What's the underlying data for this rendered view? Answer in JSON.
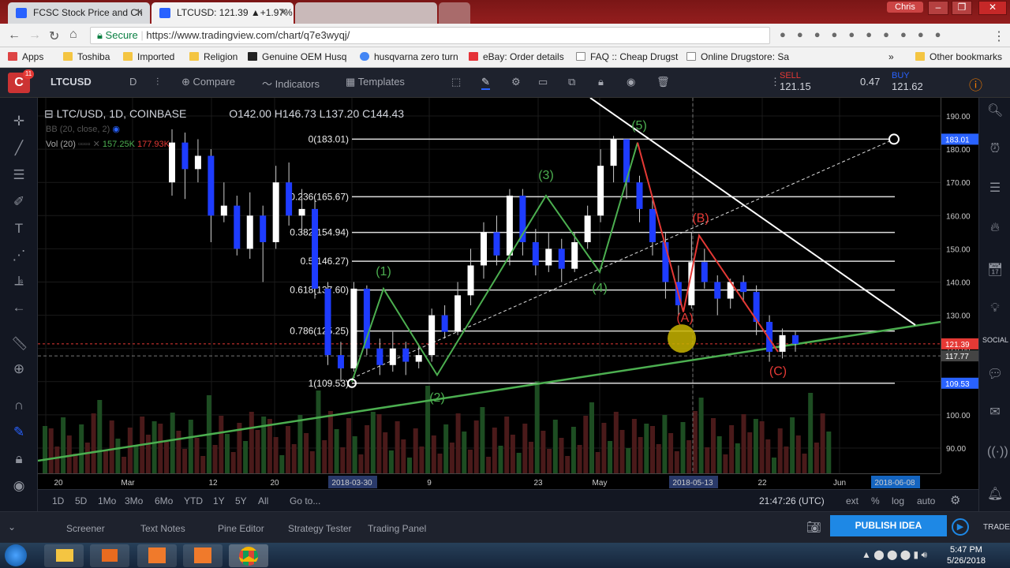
{
  "browser": {
    "tabs": [
      {
        "title": "FCSC Stock Price and Ch",
        "active": false
      },
      {
        "title": "LTCUSD: 121.39 ▲+1.97%",
        "active": true
      },
      {
        "title": "",
        "active": false
      }
    ],
    "profile": "Chris",
    "secure_label": "Secure",
    "url": "https://www.tradingview.com/chart/q7e3wyqj/",
    "bookmarks": [
      "Apps",
      "Toshiba",
      "Imported",
      "Religion",
      "Genuine OEM Husq",
      "husqvarna zero turn",
      "eBay: Order details",
      "FAQ :: Cheap Drugst",
      "Online Drugstore: Sa"
    ],
    "other_bookmarks": "Other bookmarks"
  },
  "tv": {
    "symbol": "LTCUSD",
    "interval": "D",
    "compare": "Compare",
    "indicators": "Indicators",
    "templates": "Templates",
    "sell_label": "SELL",
    "sell_price": "121.15",
    "spread": "0.47",
    "buy_label": "BUY",
    "buy_price": "121.62",
    "legend": {
      "title": "LTC/USD, 1D, COINBASE",
      "o": "O142.00",
      "h": "H146.73",
      "l": "L137.20",
      "c": "C144.43",
      "bb": "BB (20, close, 2)",
      "vol": "Vol (20)",
      "vol_v1": "157.25K",
      "vol_v2": "177.93K"
    },
    "ranges": [
      "1D",
      "5D",
      "1Mo",
      "3Mo",
      "6Mo",
      "YTD",
      "1Y",
      "5Y",
      "All"
    ],
    "goto": "Go to...",
    "clock": "21:47:26 (UTC)",
    "scale_opts": [
      "ext",
      "%",
      "log",
      "auto"
    ],
    "bottom_tabs": [
      "Screener",
      "Text Notes",
      "Pine Editor",
      "Strategy Tester",
      "Trading Panel"
    ],
    "publish": "PUBLISH IDEA",
    "social": "SOCIAL",
    "trade": "TRADE"
  },
  "chart_data": {
    "type": "candlestick",
    "x_ticks": [
      "20",
      "Mar",
      "12",
      "20",
      "2018-03-30",
      "9",
      "23",
      "May",
      "2018-05-13",
      "22",
      "Jun",
      "2018-06-08"
    ],
    "y_ticks": [
      "190.00",
      "180.00",
      "170.00",
      "160.00",
      "150.00",
      "140.00",
      "130.00",
      "120.00",
      "110.00",
      "100.00",
      "90.00"
    ],
    "price_labels": [
      {
        "text": "183.01",
        "color": "#2962ff"
      },
      {
        "text": "121.39",
        "color": "#e53935"
      },
      {
        "text": "117.77",
        "color": "#444444"
      },
      {
        "text": "109.53",
        "color": "#2962ff"
      }
    ],
    "fib_levels": [
      {
        "label": "0(183.01)",
        "price": 183.01
      },
      {
        "label": "0.236(165.67)",
        "price": 165.67
      },
      {
        "label": "0.382(154.94)",
        "price": 154.94
      },
      {
        "label": "0.5(146.27)",
        "price": 146.27
      },
      {
        "label": "0.618(137.60)",
        "price": 137.6
      },
      {
        "label": "0.786(125.25)",
        "price": 125.25
      },
      {
        "label": "1(109.53)",
        "price": 109.53
      }
    ],
    "elliott_labels": [
      {
        "text": "(1)",
        "color": "#4caf50"
      },
      {
        "text": "(2)",
        "color": "#4caf50"
      },
      {
        "text": "(3)",
        "color": "#4caf50"
      },
      {
        "text": "(4)",
        "color": "#4caf50"
      },
      {
        "text": "(5)",
        "color": "#4caf50"
      },
      {
        "text": "(A)",
        "color": "#e53935"
      },
      {
        "text": "(B)",
        "color": "#e53935"
      },
      {
        "text": "(C)",
        "color": "#e53935"
      }
    ],
    "candles": [
      {
        "o": 170,
        "c": 182,
        "h": 186,
        "l": 166
      },
      {
        "o": 182,
        "c": 174,
        "h": 185,
        "l": 165
      },
      {
        "o": 174,
        "c": 178,
        "h": 183,
        "l": 170
      },
      {
        "o": 178,
        "c": 160,
        "h": 180,
        "l": 152
      },
      {
        "o": 160,
        "c": 163,
        "h": 170,
        "l": 158
      },
      {
        "o": 163,
        "c": 150,
        "h": 166,
        "l": 148
      },
      {
        "o": 150,
        "c": 160,
        "h": 167,
        "l": 147
      },
      {
        "o": 160,
        "c": 152,
        "h": 163,
        "l": 140
      },
      {
        "o": 152,
        "c": 170,
        "h": 175,
        "l": 150
      },
      {
        "o": 170,
        "c": 160,
        "h": 176,
        "l": 157
      },
      {
        "o": 160,
        "c": 162,
        "h": 168,
        "l": 155
      },
      {
        "o": 162,
        "c": 138,
        "h": 165,
        "l": 135
      },
      {
        "o": 138,
        "c": 118,
        "h": 140,
        "l": 115
      },
      {
        "o": 118,
        "c": 114,
        "h": 122,
        "l": 110
      },
      {
        "o": 114,
        "c": 138,
        "h": 140,
        "l": 113
      },
      {
        "o": 138,
        "c": 120,
        "h": 139,
        "l": 118
      },
      {
        "o": 120,
        "c": 115,
        "h": 123,
        "l": 112
      },
      {
        "o": 115,
        "c": 120,
        "h": 125,
        "l": 113
      },
      {
        "o": 120,
        "c": 116,
        "h": 122,
        "l": 112
      },
      {
        "o": 116,
        "c": 118,
        "h": 121,
        "l": 114
      },
      {
        "o": 118,
        "c": 130,
        "h": 132,
        "l": 116
      },
      {
        "o": 130,
        "c": 125,
        "h": 133,
        "l": 123
      },
      {
        "o": 125,
        "c": 136,
        "h": 140,
        "l": 124
      },
      {
        "o": 136,
        "c": 145,
        "h": 150,
        "l": 133
      },
      {
        "o": 145,
        "c": 155,
        "h": 158,
        "l": 141
      },
      {
        "o": 155,
        "c": 148,
        "h": 160,
        "l": 145
      },
      {
        "o": 148,
        "c": 166,
        "h": 168,
        "l": 145
      },
      {
        "o": 166,
        "c": 152,
        "h": 168,
        "l": 148
      },
      {
        "o": 152,
        "c": 145,
        "h": 156,
        "l": 142
      },
      {
        "o": 145,
        "c": 150,
        "h": 155,
        "l": 143
      },
      {
        "o": 150,
        "c": 144,
        "h": 153,
        "l": 140
      },
      {
        "o": 144,
        "c": 152,
        "h": 155,
        "l": 143
      },
      {
        "o": 152,
        "c": 160,
        "h": 163,
        "l": 150
      },
      {
        "o": 160,
        "c": 175,
        "h": 180,
        "l": 158
      },
      {
        "o": 175,
        "c": 183,
        "h": 184,
        "l": 170
      },
      {
        "o": 183,
        "c": 170,
        "h": 183,
        "l": 165
      },
      {
        "o": 170,
        "c": 162,
        "h": 172,
        "l": 158
      },
      {
        "o": 162,
        "c": 152,
        "h": 165,
        "l": 148
      },
      {
        "o": 152,
        "c": 140,
        "h": 155,
        "l": 135
      },
      {
        "o": 140,
        "c": 133,
        "h": 145,
        "l": 130
      },
      {
        "o": 133,
        "c": 146,
        "h": 155,
        "l": 132
      },
      {
        "o": 146,
        "c": 140,
        "h": 150,
        "l": 138
      },
      {
        "o": 140,
        "c": 135,
        "h": 142,
        "l": 130
      },
      {
        "o": 135,
        "c": 140,
        "h": 141,
        "l": 132
      },
      {
        "o": 140,
        "c": 137,
        "h": 142,
        "l": 134
      },
      {
        "o": 137,
        "c": 128,
        "h": 139,
        "l": 124
      },
      {
        "o": 128,
        "c": 119,
        "h": 130,
        "l": 116
      },
      {
        "o": 119,
        "c": 124,
        "h": 126,
        "l": 117
      },
      {
        "o": 124,
        "c": 121.39,
        "h": 125,
        "l": 119
      }
    ]
  }
}
